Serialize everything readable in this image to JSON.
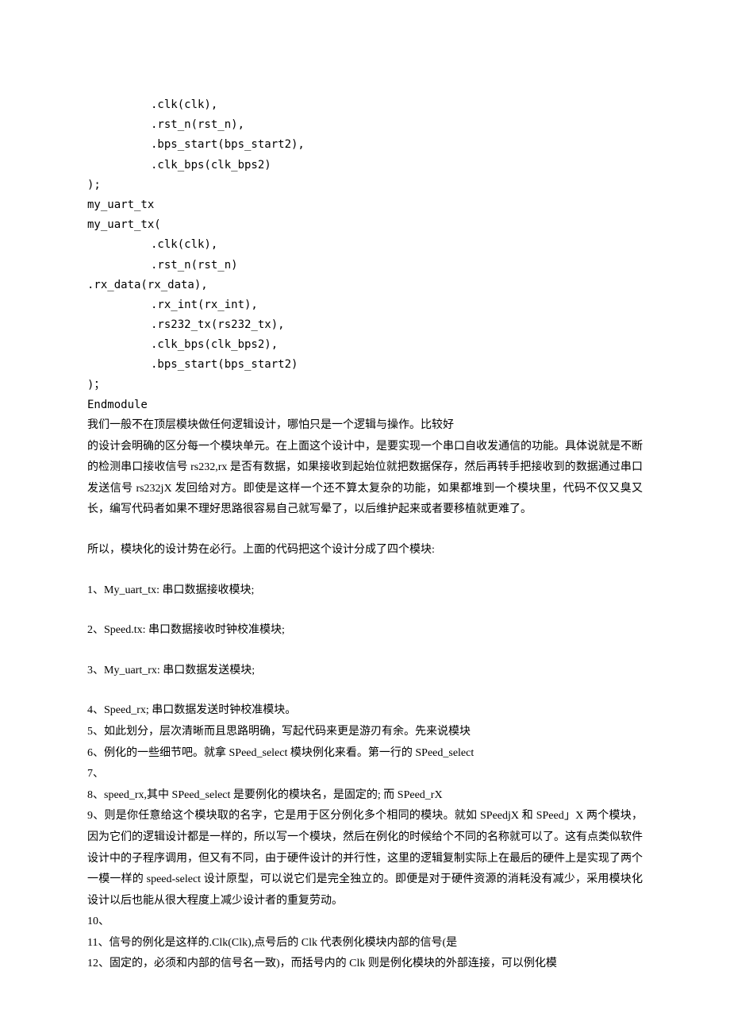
{
  "code": {
    "l1": ".clk(clk),",
    "l2": ".rst_n(rst_n),",
    "l3": ".bps_start(bps_start2),",
    "l4": ".clk_bps(clk_bps2)",
    "l5": ");",
    "l6": "my_uart_tx",
    "l7": "my_uart_tx(",
    "l8": ".clk(clk),",
    "l9": ".rst_n(rst_n)",
    "l10": ".rx_data(rx_data),",
    "l11": ".rx_int(rx_int),",
    "l12": ".rs232_tx(rs232_tx),",
    "l13": ".clk_bps(clk_bps2),",
    "l14": ".bps_start(bps_start2)",
    "l15": ")；",
    "l16": "Endmodule"
  },
  "para1": "我们一般不在顶层模块做任何逻辑设计，哪怕只是一个逻辑与操作。比较好",
  "para2": "的设计会明确的区分每一个模块单元。在上面这个设计中，是要实现一个串口自收发通信的功能。具体说就是不断的检测串口接收信号 rs232,rx 是否有数据，如果接收到起始位就把数据保存，然后再转手把接收到的数据通过串口发送信号 rs232jX 发回给对方。即使是这样一个还不算太复杂的功能，如果都堆到一个模块里，代码不仅又臭又长，编写代码者如果不理好思路很容易自己就写晕了，以后维护起来或者要移植就更难了。",
  "para3": "所以，模块化的设计势在必行。上面的代码把这个设计分成了四个模块:",
  "items": {
    "i1": "1、My_uart_tx: 串口数据接收模块;",
    "i2": "2、Speed.tx: 串口数据接收时钟校准模块;",
    "i3": "3、My_uart_rx: 串口数据发送模块;",
    "i4": "4、Speed_rx; 串口数据发送时钟校准模块。",
    "i5": "5、如此划分，层次清晰而且思路明确，写起代码来更是游刃有余。先来说模块",
    "i6": "6、例化的一些细节吧。就拿 SPeed_select 模块例化来看。第一行的 SPeed_select",
    "i7": "7、",
    "i8": "8、speed_rx,其中 SPeed_select 是要例化的模块名，是固定的; 而 SPeed_rX",
    "i9": "9、则是你任意给这个模块取的名字，它是用于区分例化多个相同的模块。就如 SPeedjX 和 SPeed」X 两个模块，因为它们的逻辑设计都是一样的，所以写一个模块，然后在例化的时候给个不同的名称就可以了。这有点类似软件设计中的子程序调用，但又有不同，由于硬件设计的并行性，这里的逻辑复制实际上在最后的硬件上是实现了两个一模一样的 speed-select 设计原型，可以说它们是完全独立的。即便是对于硬件资源的消耗没有减少，采用模块化设计以后也能从很大程度上减少设计者的重复劳动。",
    "i10": "10、",
    "i11": "11、信号的例化是这样的.Clk(Clk),点号后的 Clk 代表例化模块内部的信号(是",
    "i12": "12、固定的，必须和内部的信号名一致)，而括号内的 Clk 则是例化模块的外部连接，可以例化模"
  }
}
